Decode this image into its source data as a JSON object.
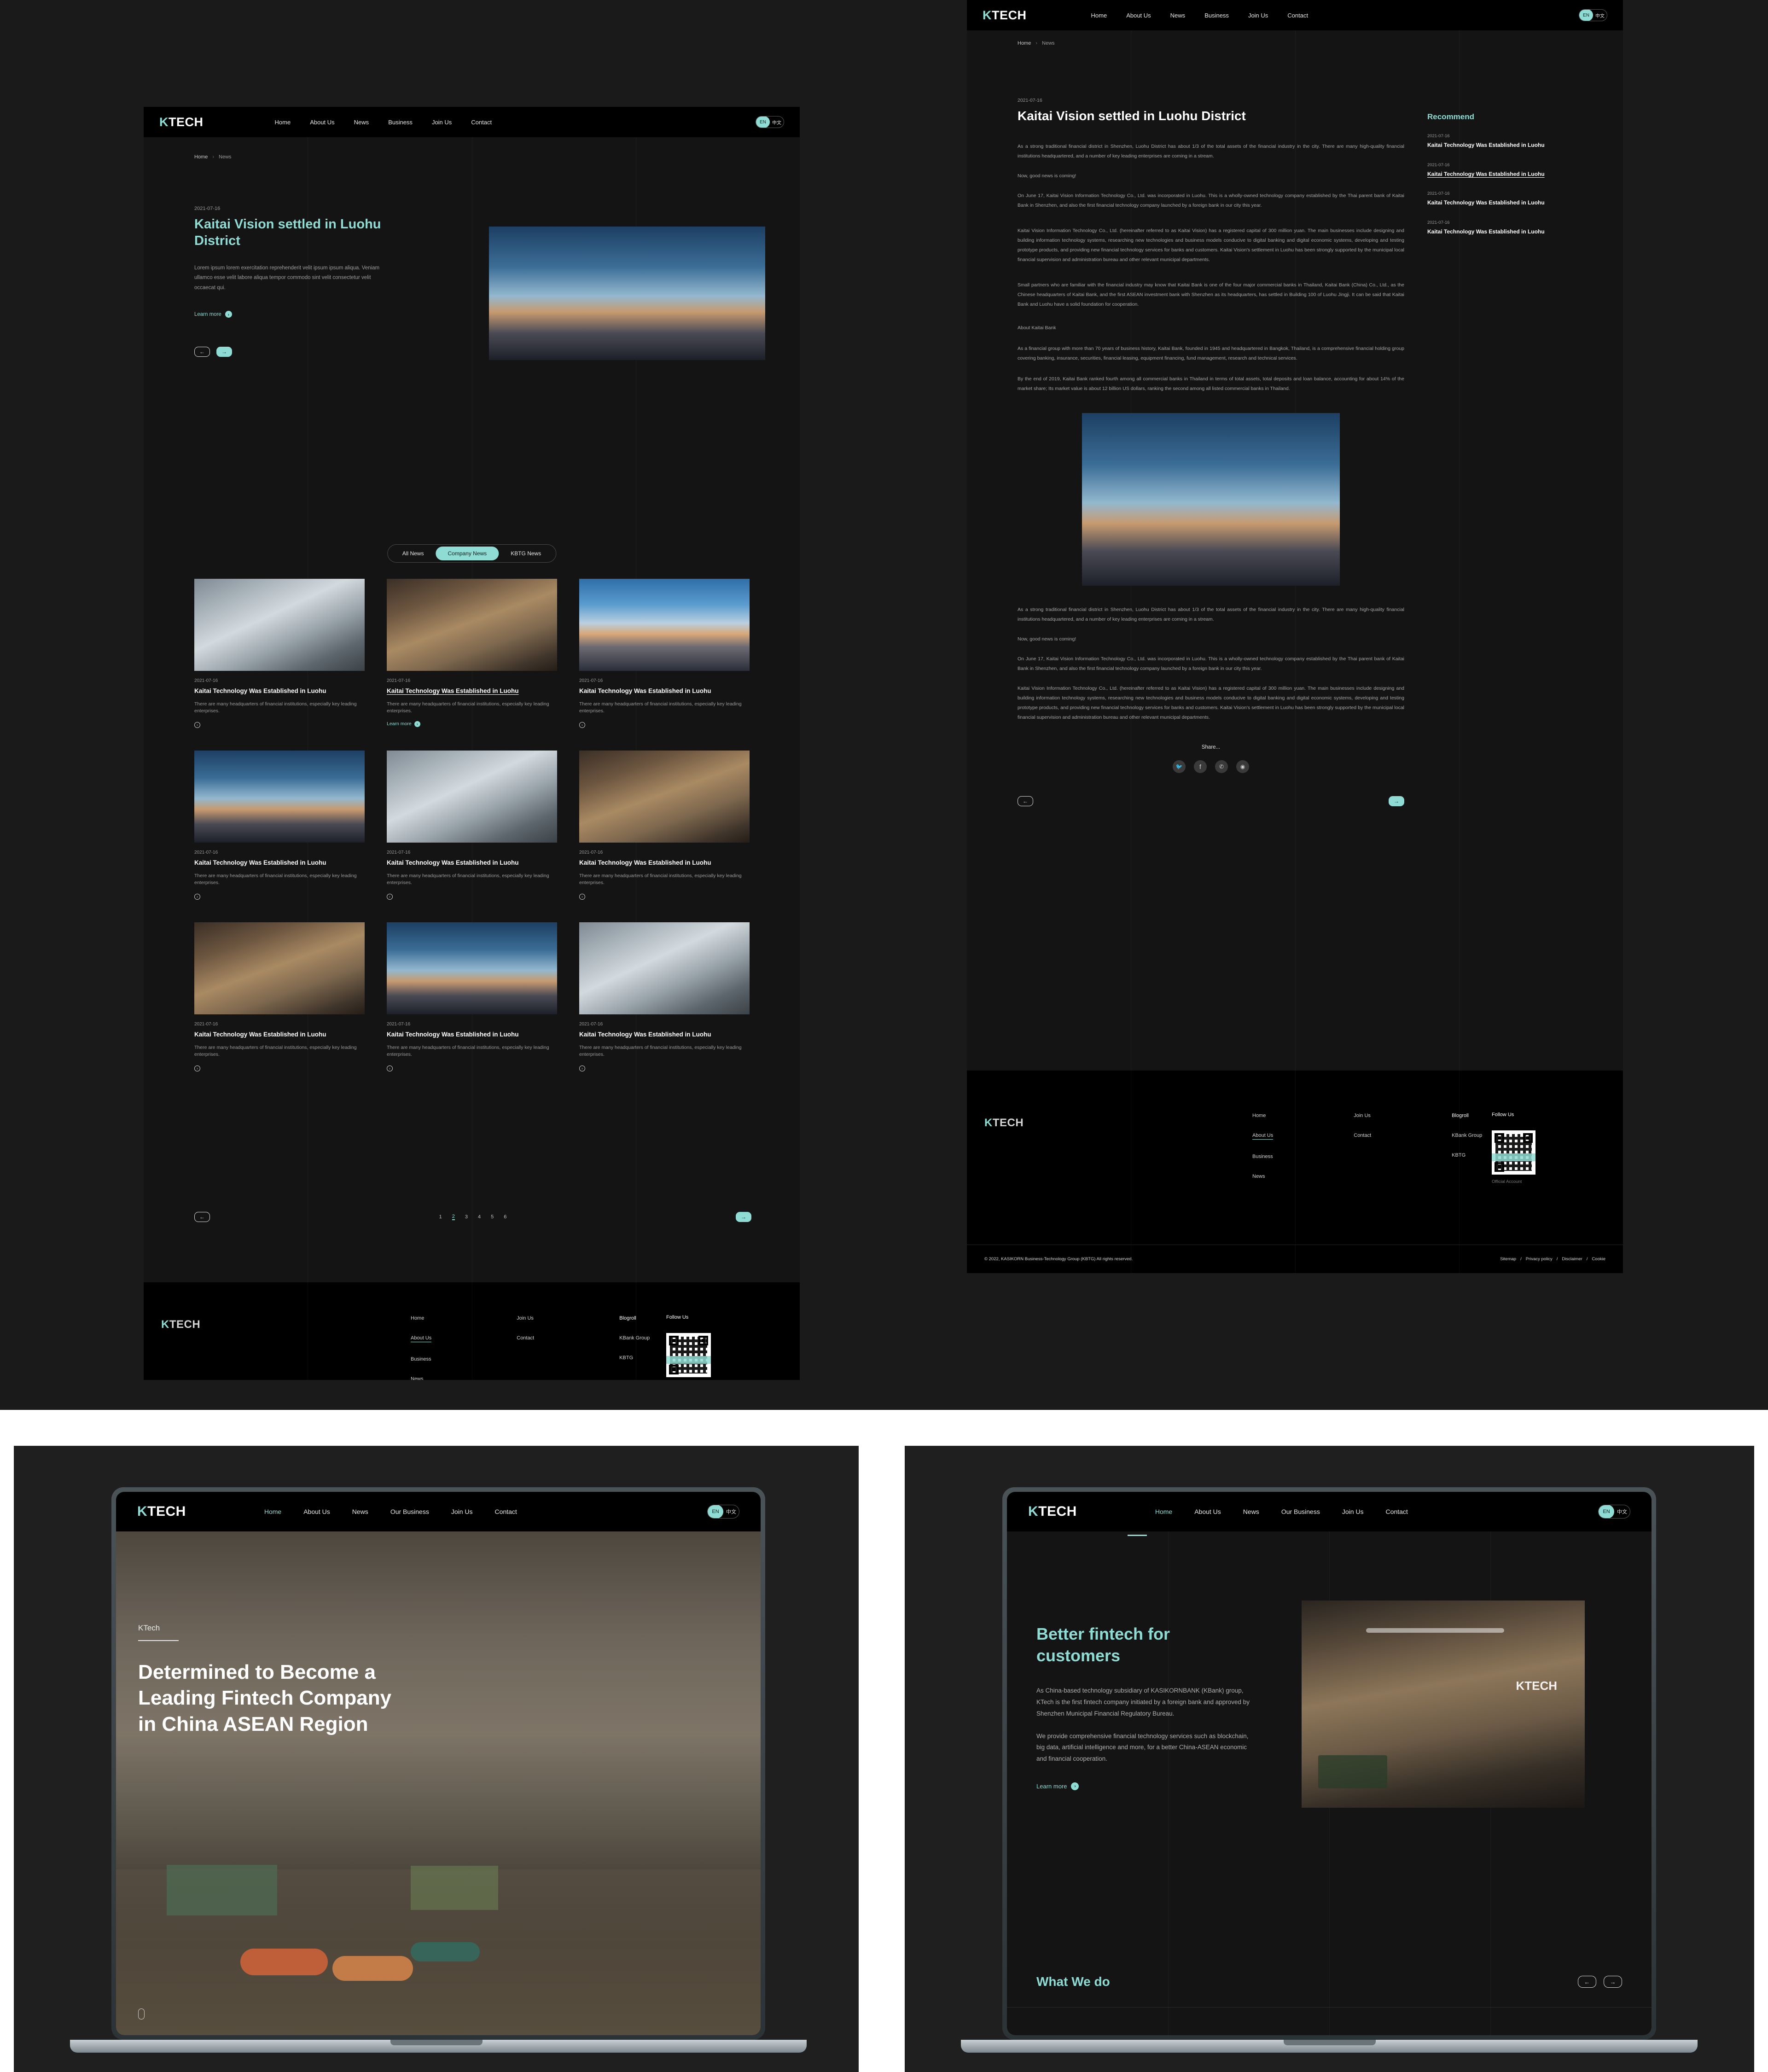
{
  "brand": {
    "logo_k": "K",
    "logo_rest": "TECH"
  },
  "nav": {
    "items": [
      "Home",
      "About Us",
      "News",
      "Business",
      "Join Us",
      "Contact"
    ],
    "items_alt": [
      "Home",
      "About Us",
      "News",
      "Our Business",
      "Join Us",
      "Contact"
    ],
    "lang_en": "EN",
    "lang_cn": "中文"
  },
  "breadcrumb": {
    "home": "Home",
    "sep": "›",
    "current": "News"
  },
  "news_list_page": {
    "hero": {
      "date": "2021-07-16",
      "title": "Kaitai Vision settled in Luohu District",
      "excerpt": "Lorem ipsum lorem exercitation reprehenderit velit ipsum ipsum aliqua. Veniam ullamco esse velit labore aliqua tempor commodo sint velit consectetur velit occaecat qui.",
      "learn_more": "Learn more",
      "prev_icon": "←",
      "next_icon": "→"
    },
    "filters": [
      {
        "label": "All News",
        "active": false
      },
      {
        "label": "Company News",
        "active": true
      },
      {
        "label": "KBTG News",
        "active": false
      }
    ],
    "cards": [
      {
        "date": "2021-07-16",
        "title": "Kaitai Technology Was Established in Luohu",
        "desc": "There are many headquarters of financial institutions, especially key leading enterprises.",
        "photo": "ph-build",
        "link_style": "arrow",
        "underline": false
      },
      {
        "date": "2021-07-16",
        "title": "Kaitai Technology Was Established in Luohu",
        "desc": "There are many headquarters of financial institutions, especially key leading enterprises.",
        "photo": "ph-office",
        "link_style": "learn-more",
        "learn_more": "Learn more",
        "underline": true
      },
      {
        "date": "2021-07-16",
        "title": "Kaitai Technology Was Established in Luohu",
        "desc": "There are many headquarters of financial institutions, especially key leading enterprises.",
        "photo": "ph-city",
        "link_style": "arrow",
        "underline": false
      },
      {
        "date": "2021-07-16",
        "title": "Kaitai Technology Was Established in Luohu",
        "desc": "There are many headquarters of financial institutions, especially key leading enterprises.",
        "photo": "ph-city2",
        "link_style": "arrow",
        "underline": false
      },
      {
        "date": "2021-07-16",
        "title": "Kaitai Technology Was Established in Luohu",
        "desc": "There are many headquarters of financial institutions, especially key leading enterprises.",
        "photo": "ph-build",
        "link_style": "arrow",
        "underline": false
      },
      {
        "date": "2021-07-16",
        "title": "Kaitai Technology Was Established in Luohu",
        "desc": "There are many headquarters of financial institutions, especially key leading enterprises.",
        "photo": "ph-office",
        "link_style": "arrow",
        "underline": false
      },
      {
        "date": "2021-07-16",
        "title": "Kaitai Technology Was Established in Luohu",
        "desc": "There are many headquarters of financial institutions, especially key leading enterprises.",
        "photo": "ph-office",
        "link_style": "arrow",
        "underline": false
      },
      {
        "date": "2021-07-16",
        "title": "Kaitai Technology Was Established in Luohu",
        "desc": "There are many headquarters of financial institutions, especially key leading enterprises.",
        "photo": "ph-city2",
        "link_style": "arrow",
        "underline": false
      },
      {
        "date": "2021-07-16",
        "title": "Kaitai Technology Was Established in Luohu",
        "desc": "There are many headquarters of financial institutions, especially key leading enterprises.",
        "photo": "ph-build",
        "link_style": "arrow",
        "underline": false
      }
    ],
    "pagination": {
      "pages": [
        "1",
        "2",
        "3",
        "4",
        "5",
        "6"
      ],
      "current": "2",
      "prev_icon": "←",
      "next_icon": "→"
    }
  },
  "article_page": {
    "date": "2021-07-16",
    "title": "Kaitai Vision settled in Luohu District",
    "paragraphs": [
      "As a strong traditional financial district in Shenzhen, Luohu District has about 1/3 of the total assets of the financial industry in the city. There are many high-quality financial institutions headquartered, and a number of key leading enterprises are coming in a stream.",
      "Now, good news is coming!",
      "On June 17, Kaitai Vision Information Technology Co., Ltd. was incorporated in Luohu. This is a wholly-owned technology company established by the Thai parent bank of Kaitai Bank in Shenzhen, and also the first financial technology company launched by a foreign bank in our city this year.",
      "Kaitai Vision Information Technology Co., Ltd. (hereinafter referred to as Kaitai Vision) has a registered capital of 300 million yuan. The main businesses include designing and building information technology systems, researching new technologies and business models conducive to digital banking and digital economic systems, developing and testing prototype products, and providing new financial technology services for banks and customers. Kaitai Vision's settlement in Luohu has been strongly supported by the municipal local financial supervision and administration bureau and other relevant municipal departments.",
      "Small partners who are familiar with the financial industry may know that Kaitai Bank is one of the four major commercial banks in Thailand, Kaitai Bank (China) Co., Ltd., as the Chinese headquarters of Kaitai Bank, and the first ASEAN investment bank with Shenzhen as its headquarters, has settled in Building 100 of Luohu Jingji. It can be said that Kaitai Bank and Luohu have a solid foundation for cooperation.",
      "About Kaitai Bank",
      "As a financial group with more than 70 years of business history, Kaitai Bank, founded in 1945 and headquartered in Bangkok, Thailand, is a comprehensive financial holding group covering banking, insurance, securities, financial leasing, equipment financing, fund management, research and technical services.",
      "By the end of 2019, Kaitai Bank ranked fourth among all commercial banks in Thailand in terms of total assets, total deposits and loan balance, accounting for about 14% of the market share; Its market value is about 12 billion US dollars, ranking the second among all listed commercial banks in Thailand."
    ],
    "paragraphs_after_image": [
      "As a strong traditional financial district in Shenzhen, Luohu District has about 1/3 of the total assets of the financial industry in the city. There are many high-quality financial institutions headquartered, and a number of key leading enterprises are coming in a stream.",
      "Now, good news is coming!",
      "On June 17, Kaitai Vision Information Technology Co., Ltd. was incorporated in Luohu. This is a wholly-owned technology company established by the Thai parent bank of Kaitai Bank in Shenzhen, and also the first financial technology company launched by a foreign bank in our city this year.",
      "Kaitai Vision Information Technology Co., Ltd. (hereinafter referred to as Kaitai Vision) has a registered capital of 300 million yuan. The main businesses include designing and building information technology systems, researching new technologies and business models conducive to digital banking and digital economic systems, developing and testing prototype products, and providing new financial technology services for banks and customers. Kaitai Vision's settlement in Luohu has been strongly supported by the municipal local financial supervision and administration bureau and other relevant municipal departments."
    ],
    "share_label": "Share...",
    "share_icons": [
      "twitter-icon",
      "facebook-icon",
      "wechat-icon",
      "weibo-icon"
    ],
    "share_glyphs": [
      "🐦",
      "f",
      "✆",
      "◉"
    ],
    "prev_icon": "←",
    "next_icon": "→",
    "recommend": {
      "heading": "Recommend",
      "items": [
        {
          "date": "2021-07-16",
          "title": "Kaitai Technology Was Established in Luohu",
          "underline": false
        },
        {
          "date": "2021-07-16",
          "title": "Kaitai Technology Was Established in Luohu",
          "underline": true
        },
        {
          "date": "2021-07-16",
          "title": "Kaitai Technology Was Established in Luohu",
          "underline": false
        },
        {
          "date": "2021-07-16",
          "title": "Kaitai Technology Was Established in Luohu",
          "underline": false
        }
      ]
    }
  },
  "footer": {
    "columns": [
      {
        "items": [
          "Home",
          "About Us",
          "Business",
          "News"
        ],
        "underline_index": 1
      },
      {
        "items": [
          "Join Us",
          "Contact"
        ],
        "underline_index": -1
      },
      {
        "items": [
          "Blogroll",
          "KBank Group",
          "KBTG"
        ],
        "underline_index": -1
      }
    ],
    "follow_us": "Follow Us",
    "qr_caption": "Official Account",
    "copyright": "© 2022, KASIKORN Business-Technology Group (KBTG) All rights reserved.",
    "legal_links": [
      "Sitemap",
      "Privacy policy",
      "Disclaimer",
      "Cookie"
    ],
    "legal_sep": "/"
  },
  "mock_left": {
    "eyebrow": "KTech",
    "headline_lines": [
      "Determined to Become a",
      "Leading Fintech Company",
      "in China ASEAN Region"
    ],
    "active_nav": "Home"
  },
  "mock_right": {
    "title_lines": [
      "Better fintech for",
      "customers"
    ],
    "paragraphs": [
      "As China-based technology subsidiary of KASIKORNBANK (KBank) group, KTech is the first fintech company initiated by a foreign bank and approved by Shenzhen Municipal Financial Regulatory Bureau.",
      "We provide comprehensive financial technology services such as blockchain, big data, artificial intelligence and more, for a better China-ASEAN economic and financial cooperation."
    ],
    "learn_more": "Learn more",
    "section_title": "What We do",
    "prev_icon": "←",
    "next_icon": "→",
    "active_nav": "Home",
    "image_logo_k": "K",
    "image_logo_rest": "TECH"
  },
  "colors": {
    "accent": "#8fdcd4",
    "bg_dark": "#141414",
    "bg_black": "#000000",
    "page_bg": "#1a1a1a"
  }
}
